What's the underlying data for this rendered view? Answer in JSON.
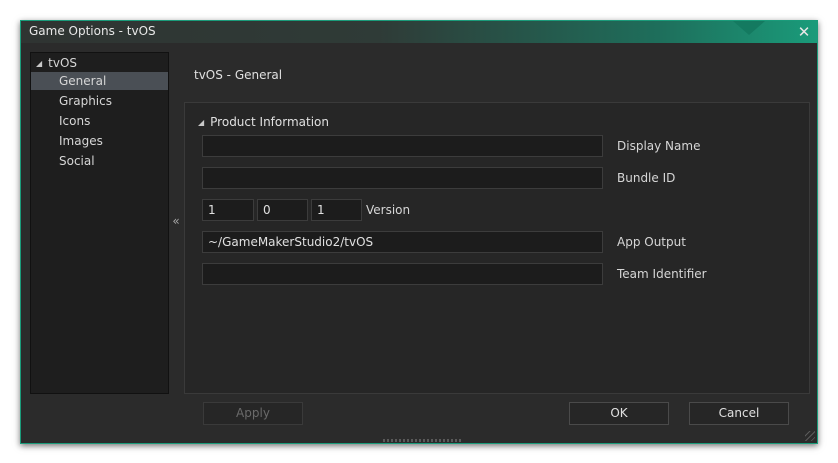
{
  "window": {
    "title": "Game Options - tvOS",
    "close_glyph": "✕"
  },
  "tree": {
    "root": "tvOS",
    "root_glyph": "◢",
    "items": [
      {
        "label": "General",
        "selected": true
      },
      {
        "label": "Graphics",
        "selected": false
      },
      {
        "label": "Icons",
        "selected": false
      },
      {
        "label": "Images",
        "selected": false
      },
      {
        "label": "Social",
        "selected": false
      }
    ]
  },
  "collapse_glyph": "«",
  "section_title": "tvOS - General",
  "group": {
    "title": "Product Information",
    "glyph": "◢"
  },
  "fields": {
    "display_name": {
      "label": "Display Name",
      "value": ""
    },
    "bundle_id": {
      "label": "Bundle ID",
      "value": ""
    },
    "version": {
      "label": "Version",
      "major": "1",
      "minor": "0",
      "patch": "1"
    },
    "app_output": {
      "label": "App Output",
      "value": "~/GameMakerStudio2/tvOS"
    },
    "team_identifier": {
      "label": "Team Identifier",
      "value": ""
    }
  },
  "buttons": {
    "apply": "Apply",
    "ok": "OK",
    "cancel": "Cancel"
  },
  "colors": {
    "accent": "#1a9b7a",
    "window_bg": "#2b2b2b",
    "selected_item": "#4a4f55"
  }
}
